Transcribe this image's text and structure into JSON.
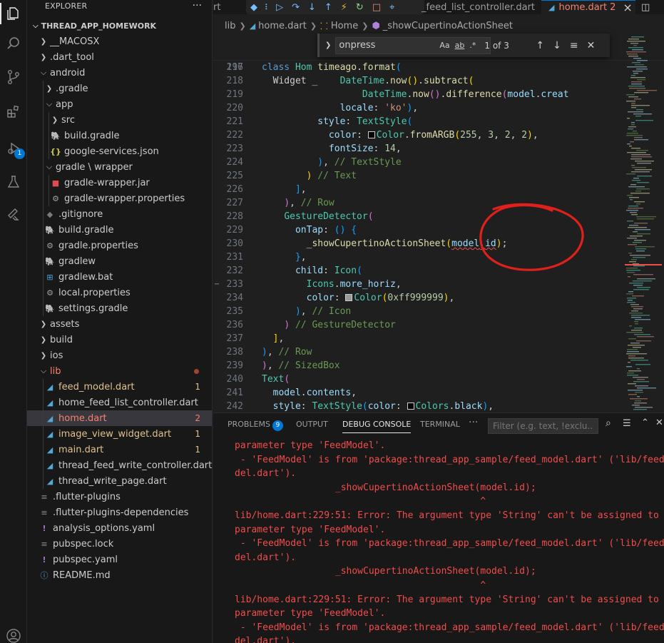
{
  "sidebar": {
    "title": "EXPLORER",
    "more": "···",
    "project": "THREAD_APP_HOMEWORK",
    "tree": [
      {
        "label": "__MACOSX",
        "depth": 1,
        "kind": "folder",
        "open": false
      },
      {
        "label": ".dart_tool",
        "depth": 1,
        "kind": "folder",
        "open": false
      },
      {
        "label": "android",
        "depth": 1,
        "kind": "folder",
        "open": true
      },
      {
        "label": ".gradle",
        "depth": 2,
        "kind": "folder",
        "open": false
      },
      {
        "label": "app",
        "depth": 2,
        "kind": "folder",
        "open": true
      },
      {
        "label": "src",
        "depth": 3,
        "kind": "folder",
        "open": false
      },
      {
        "label": "build.gradle",
        "depth": 3,
        "kind": "gradle"
      },
      {
        "label": "google-services.json",
        "depth": 3,
        "kind": "json"
      },
      {
        "label": "gradle \\ wrapper",
        "depth": 2,
        "kind": "folder",
        "open": true
      },
      {
        "label": "gradle-wrapper.jar",
        "depth": 3,
        "kind": "jar"
      },
      {
        "label": "gradle-wrapper.properties",
        "depth": 3,
        "kind": "gear"
      },
      {
        "label": ".gitignore",
        "depth": 2,
        "kind": "git"
      },
      {
        "label": "build.gradle",
        "depth": 2,
        "kind": "gradle"
      },
      {
        "label": "gradle.properties",
        "depth": 2,
        "kind": "gear"
      },
      {
        "label": "gradlew",
        "depth": 2,
        "kind": "gradle"
      },
      {
        "label": "gradlew.bat",
        "depth": 2,
        "kind": "windows"
      },
      {
        "label": "local.properties",
        "depth": 2,
        "kind": "gear"
      },
      {
        "label": "settings.gradle",
        "depth": 2,
        "kind": "gradle"
      },
      {
        "label": "assets",
        "depth": 1,
        "kind": "folder",
        "open": false
      },
      {
        "label": "build",
        "depth": 1,
        "kind": "folder",
        "open": false
      },
      {
        "label": "ios",
        "depth": 1,
        "kind": "folder",
        "open": false
      },
      {
        "label": "lib",
        "depth": 1,
        "kind": "folder",
        "open": true,
        "state": "err",
        "dot": true
      },
      {
        "label": "feed_model.dart",
        "depth": 2,
        "kind": "dart",
        "state": "mod",
        "status": "1"
      },
      {
        "label": "home_feed_list_controller.dart",
        "depth": 2,
        "kind": "dart"
      },
      {
        "label": "home.dart",
        "depth": 2,
        "kind": "dart",
        "state": "err",
        "status": "2",
        "selected": true
      },
      {
        "label": "image_view_widget.dart",
        "depth": 2,
        "kind": "dart",
        "state": "mod",
        "status": "1"
      },
      {
        "label": "main.dart",
        "depth": 2,
        "kind": "dart",
        "state": "mod",
        "status": "1"
      },
      {
        "label": "thread_feed_write_controller.dart",
        "depth": 2,
        "kind": "dart"
      },
      {
        "label": "thread_write_page.dart",
        "depth": 2,
        "kind": "dart"
      },
      {
        "label": ".flutter-plugins",
        "depth": 1,
        "kind": "plain"
      },
      {
        "label": ".flutter-plugins-dependencies",
        "depth": 1,
        "kind": "plain"
      },
      {
        "label": "analysis_options.yaml",
        "depth": 1,
        "kind": "yaml"
      },
      {
        "label": "pubspec.lock",
        "depth": 1,
        "kind": "plain"
      },
      {
        "label": "pubspec.yaml",
        "depth": 1,
        "kind": "yaml"
      },
      {
        "label": "README.md",
        "depth": 1,
        "kind": "info"
      }
    ]
  },
  "activity_badge": "1",
  "tabs": {
    "clipped_left": "rt",
    "feed_tab": "_feed_list_controller.dart",
    "active_tab": "home.dart",
    "active_tab_count": "2",
    "close": "×"
  },
  "breadcrumb": [
    "lib",
    "home.dart",
    "Home",
    "_showCupertinoActionSheet"
  ],
  "find": {
    "query": "onpress",
    "count": "1 of 3",
    "opt_case": "Aa",
    "opt_word": "ab",
    "opt_regex": ".*"
  },
  "code": {
    "sticky1": {
      "num": "14",
      "pre": "class ",
      "name": "Hom"
    },
    "sticky2": {
      "num": "196",
      "pre": "  Widget _"
    },
    "lines": [
      {
        "num": "217",
        "html": "          <span class=\"fn\">timeago</span><span class=\"pc\">.</span><span class=\"fn\">format</span><span class=\"br3\">(</span>"
      },
      {
        "num": "218",
        "html": "              <span class=\"ty\">DateTime</span>.<span class=\"fn\">now</span><span class=\"br1\">()</span>.<span class=\"fn\">subtract</span><span class=\"br1\">(</span>"
      },
      {
        "num": "219",
        "html": "                  <span class=\"ty\">DateTime</span>.<span class=\"fn\">now</span><span class=\"br2\">()</span>.<span class=\"fn\">difference</span><span class=\"br2\">(</span><span class=\"pr\">model</span>.<span class=\"pr\">creat</span>"
      },
      {
        "num": "220",
        "html": "              <span class=\"pr\">locale</span>: <span class=\"str\">'ko'</span><span class=\"br3\">)</span>,"
      },
      {
        "num": "221",
        "html": "          <span class=\"pr\">style</span>: <span class=\"ty\">TextStyle</span><span class=\"br3\">(</span>"
      },
      {
        "num": "222",
        "html": "            <span class=\"pr\">color</span>: <span class=\"sw\" style=\"background:#030202\"></span><span class=\"ty\">Color</span>.<span class=\"fn\">fromARGB</span><span class=\"br1\">(</span><span class=\"num2\">255</span>, <span class=\"num2\">3</span>, <span class=\"num2\">2</span>, <span class=\"num2\">2</span><span class=\"br1\">)</span>,"
      },
      {
        "num": "223",
        "html": "            <span class=\"pr\">fontSize</span>: <span class=\"num2\">14</span>,"
      },
      {
        "num": "224",
        "html": "          <span class=\"br3\">)</span>, <span class=\"cm\">// TextStyle</span>"
      },
      {
        "num": "225",
        "html": "        <span class=\"br1\">)</span> <span class=\"cm\">// Text</span>"
      },
      {
        "num": "226",
        "html": "      <span class=\"br3\">]</span>,"
      },
      {
        "num": "227",
        "html": "    <span class=\"br2\">)</span>, <span class=\"cm\">// Row</span>"
      },
      {
        "num": "228",
        "html": "    <span class=\"ty\">GestureDetector</span><span class=\"br2\">(</span>"
      },
      {
        "num": "229",
        "html": "      <span class=\"pr\">onTap</span>: <span class=\"br3\">()</span> <span class=\"br3\">{</span>"
      },
      {
        "num": "230",
        "html": "        <span class=\"fn\">_showCupertinoActionSheet</span><span class=\"br1\">(</span><span class=\"squig\"><span class=\"pr\">model</span>.<span class=\"pr\">id</span></span><span class=\"br1\">)</span>;"
      },
      {
        "num": "231",
        "html": "      <span class=\"br3\">}</span>,"
      },
      {
        "num": "232",
        "html": "      <span class=\"pr\">child</span>: <span class=\"ty\">Icon</span><span class=\"br3\">(</span>"
      },
      {
        "num": "233",
        "html": "        <span class=\"ty\">Icons</span>.<span class=\"pr\">more_horiz</span>,"
      },
      {
        "num": "234",
        "html": "        <span class=\"pr\">color</span>: <span class=\"sw\" style=\"background:#999999\"></span><span class=\"ty\">Color</span><span class=\"br1\">(</span><span class=\"num2\">0xff999999</span><span class=\"br1\">)</span>,"
      },
      {
        "num": "235",
        "html": "      <span class=\"br3\">)</span>, <span class=\"cm\">// Icon</span>"
      },
      {
        "num": "236",
        "html": "    <span class=\"br2\">)</span> <span class=\"cm\">// GestureDetector</span>"
      },
      {
        "num": "237",
        "html": "  <span class=\"br1\">]</span>,"
      },
      {
        "num": "238",
        "html": "<span class=\"br3\">)</span>, <span class=\"cm\">// Row</span>"
      },
      {
        "num": "239",
        "html": "<span class=\"br2\">)</span>, <span class=\"cm\">// SizedBox</span>"
      },
      {
        "num": "240",
        "html": "<span class=\"ty\">Text</span><span class=\"br2\">(</span>"
      },
      {
        "num": "241",
        "html": "  <span class=\"pr\">model</span>.<span class=\"pr\">contents</span>,"
      },
      {
        "num": "242",
        "html": "  <span class=\"pr\">style</span>: <span class=\"ty\">TextStyle</span><span class=\"br3\">(</span><span class=\"pr\">color</span>: <span class=\"sw\" style=\"background:#000000\"></span><span class=\"ty\">Colors</span>.<span class=\"pr\">black</span><span class=\"br3\">)</span>,"
      }
    ]
  },
  "panel": {
    "tabs": [
      "PROBLEMS",
      "OUTPUT",
      "DEBUG CONSOLE",
      "TERMINAL"
    ],
    "problems_count": "9",
    "more": "···",
    "filter_placeholder": "Filter (e.g. text, !exclu...",
    "console": [
      "parameter type 'FeedModel'.",
      " - 'FeedModel' is from 'package:thread_app_sample/feed_model.dart' ('lib/feed_mo",
      "del.dart').",
      "                  _showCupertinoActionSheet(model.id);",
      "                                            ^",
      "lib/home.dart:229:51: Error: The argument type 'String' can't be assigned to the",
      "parameter type 'FeedModel'.",
      " - 'FeedModel' is from 'package:thread_app_sample/feed_model.dart' ('lib/feed_mo",
      "del.dart').",
      "                  _showCupertinoActionSheet(model.id);",
      "                                            ^",
      "lib/home.dart:229:51: Error: The argument type 'String' can't be assigned to the",
      "parameter type 'FeedModel'.",
      " - 'FeedModel' is from 'package:thread_app_sample/feed_model.dart' ('lib/feed_mo",
      "del.dart')."
    ]
  },
  "colors": {
    "accent": "#0078d4",
    "error": "#f14c4c",
    "modified": "#e2c08d",
    "annotation": "#e0201a"
  }
}
